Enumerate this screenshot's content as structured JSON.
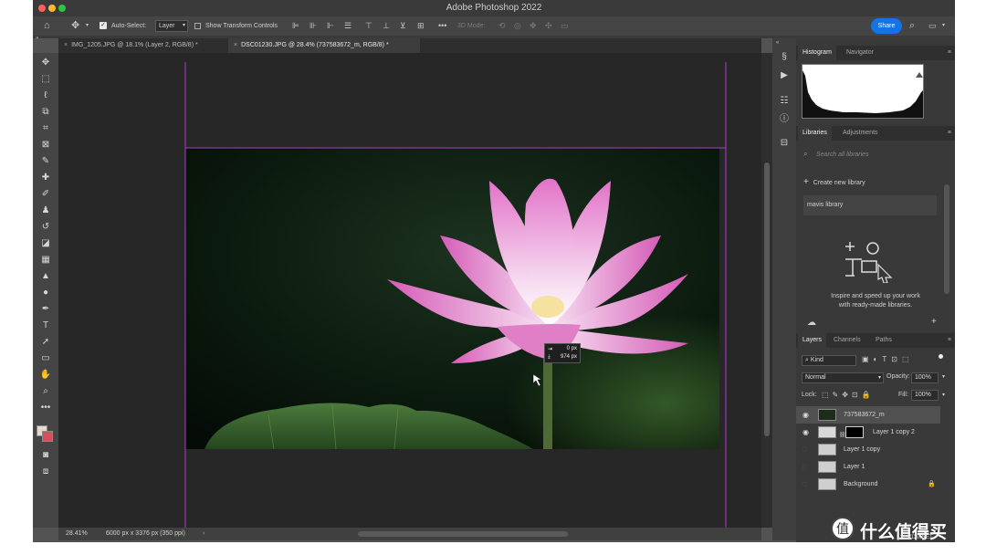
{
  "window": {
    "title": "Adobe Photoshop 2022"
  },
  "options_bar": {
    "auto_select_label": "Auto-Select:",
    "auto_select_value": "Layer",
    "transform_controls_label": "Show Transform Controls",
    "mode_3d_label": "3D Mode:",
    "share_label": "Share"
  },
  "tabs": [
    {
      "label": "IMG_1205.JPG @ 18.1% (Layer 2, RGB/8) *",
      "active": false
    },
    {
      "label": "DSC01230.JPG @ 28.4% (737583672_m, RGB/8) *",
      "active": true
    }
  ],
  "canvas": {
    "measure_x": "0 px",
    "measure_y": "974 px"
  },
  "status": {
    "zoom": "28.41%",
    "doc_info": "6000 px x 3376 px (350 ppi)"
  },
  "histogram_panel": {
    "tabs": [
      "Histogram",
      "Navigator"
    ]
  },
  "libraries_panel": {
    "tabs": [
      "Libraries",
      "Adjustments"
    ],
    "search_placeholder": "Search all libraries",
    "create_label": "Create new library",
    "library_item": "mavis library",
    "promo_line1": "Inspire and speed up your work",
    "promo_line2": "with ready-made libraries."
  },
  "layers_panel": {
    "tabs": [
      "Layers",
      "Channels",
      "Paths"
    ],
    "filter_kind": "Kind",
    "blend_mode": "Normal",
    "opacity_label": "Opacity:",
    "opacity_value": "100%",
    "lock_label": "Lock:",
    "fill_label": "Fill:",
    "fill_value": "100%",
    "layers": [
      {
        "name": "737583672_m",
        "visible": true,
        "selected": true
      },
      {
        "name": "Layer 1 copy 2",
        "visible": true,
        "selected": false
      },
      {
        "name": "Layer 1 copy",
        "visible": false,
        "selected": false
      },
      {
        "name": "Layer 1",
        "visible": false,
        "selected": false
      },
      {
        "name": "Background",
        "visible": false,
        "selected": false
      }
    ]
  },
  "watermark": {
    "text": "什么值得买",
    "sub": "SMZDM.NET"
  },
  "colors": {
    "accent": "#1473e6",
    "guide": "#b03ad6",
    "petal": "#e07fc6"
  }
}
